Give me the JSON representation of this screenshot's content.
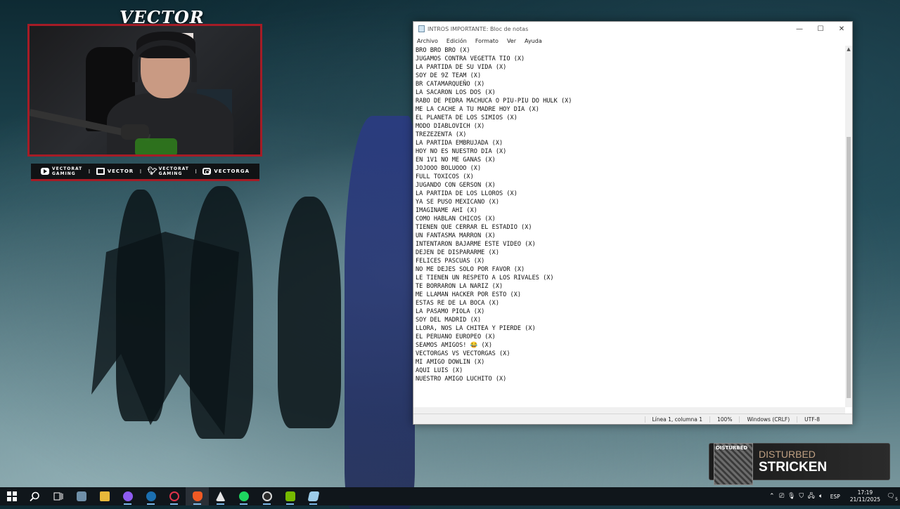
{
  "overlay": {
    "brand": "VECTOR",
    "social": [
      {
        "icon": "youtube-icon",
        "line1": "VECTORAT",
        "line2": "GAMING"
      },
      {
        "icon": "twitch-icon",
        "line1": "VECTOR",
        "line2": ""
      },
      {
        "icon": "twitter-icon",
        "line1": "VECTORAT",
        "line2": "GAMING"
      },
      {
        "icon": "instagram-icon",
        "line1": "VECTORGA",
        "line2": ""
      }
    ],
    "separator": "I"
  },
  "notepad": {
    "title": "INTROS IMPORTANTE: Bloc de notas",
    "menu": [
      "Archivo",
      "Edición",
      "Formato",
      "Ver",
      "Ayuda"
    ],
    "window_controls": {
      "minimize": "—",
      "maximize": "☐",
      "close": "✕"
    },
    "lines": [
      "BRO BRO BRO (X)",
      "JUGAMOS CONTRA VEGETTA TIO (X)",
      "LA PARTIDA DE SU VIDA (X)",
      "SOY DE 9Z TEAM (X)",
      "BR CATAMARQUEÑO (X)",
      "LA SACARON LOS DOS (X)",
      "RABO DE PEDRA MACHUCA O PIU-PIU DO HULK (X)",
      "ME LA CACHE A TU MADRE HOY DIA (X)",
      "EL PLANETA DE LOS SIMIOS (X)",
      "MODO DIABLOVICH (X)",
      "TREZEZENTA (X)",
      "LA PARTIDA EMBRUJADA (X)",
      "HOY NO ES NUESTRO DIA (X)",
      "EN 1V1 NO ME GANAS (X)",
      "JOJOOO BOLUOOO (X)",
      "FULL TOXICOS (X)",
      "JUGANDO CON GERSON (X)",
      "LA PARTIDA DE LOS LLOROS (X)",
      "YA SE PUSO MEXICANO (X)",
      "IMAGINAME AHI (X)",
      "COMO HABLAN CHICOS (X)",
      "TIENEN QUE CERRAR EL ESTADIO (X)",
      "UN FANTASMA MARRON (X)",
      "INTENTARON BAJARME ESTE VIDEO (X)",
      "DEJEN DE DISPARARME (X)",
      "FELICES PASCUAS (X)",
      "NO ME DEJES SOLO POR FAVOR (X)",
      "LE TIENEN UN RESPETO A LOS RIVALES (X)",
      "TE BORRARON LA NARIZ (X)",
      "ME LLAMAN HACKER POR ESTO (X)",
      "ESTAS RE DE LA BOCA (X)",
      "LA PASAMO PIOLA (X)",
      "SOY DEL MADRID (X)",
      "LLORA, NOS LA CHITEA Y PIERDE (X)",
      "EL PERUANO EUROPEO (X)",
      "SEAMOS AMIGOS! 😂 (X)",
      "VECTORGAS VS VECTORGAS (X)",
      "MI AMIGO DOWLIN (X)",
      "AQUI LUIS (X)",
      "NUESTRO AMIGO LUCHITO (X)"
    ],
    "status": {
      "position": "Línea 1, columna 1",
      "zoom": "100%",
      "line_ending": "Windows (CRLF)",
      "encoding": "UTF-8"
    }
  },
  "now_playing": {
    "album_text": "DISTURBED",
    "artist": "DISTURBED",
    "song": "STRICKEN"
  },
  "taskbar": {
    "apps": [
      {
        "name": "start-button",
        "color": "#ffffff"
      },
      {
        "name": "search-button",
        "color": "#ffffff"
      },
      {
        "name": "task-view-button",
        "color": "#ffffff"
      },
      {
        "name": "app-generic",
        "color": "#6f8fa8"
      },
      {
        "name": "file-explorer",
        "color": "#e8b83a"
      },
      {
        "name": "discord",
        "color": "#8e5cf0"
      },
      {
        "name": "steam",
        "color": "#1b6fb0"
      },
      {
        "name": "opera-gx",
        "color": "#e0334a"
      },
      {
        "name": "brave",
        "color": "#f05a24"
      },
      {
        "name": "app-a",
        "color": "#e5e5e5"
      },
      {
        "name": "spotify",
        "color": "#1ed760"
      },
      {
        "name": "obs",
        "color": "#d9d9d9"
      },
      {
        "name": "nvidia",
        "color": "#76b900"
      },
      {
        "name": "notepad",
        "color": "#9ccbe8"
      }
    ],
    "tray_icons": [
      "chevron-up-icon",
      "usb-icon",
      "microphone-icon",
      "security-icon",
      "network-icon",
      "volume-icon"
    ],
    "language": "ESP",
    "time": "17:19",
    "date": "21/11/2025",
    "notification_count": "5"
  }
}
